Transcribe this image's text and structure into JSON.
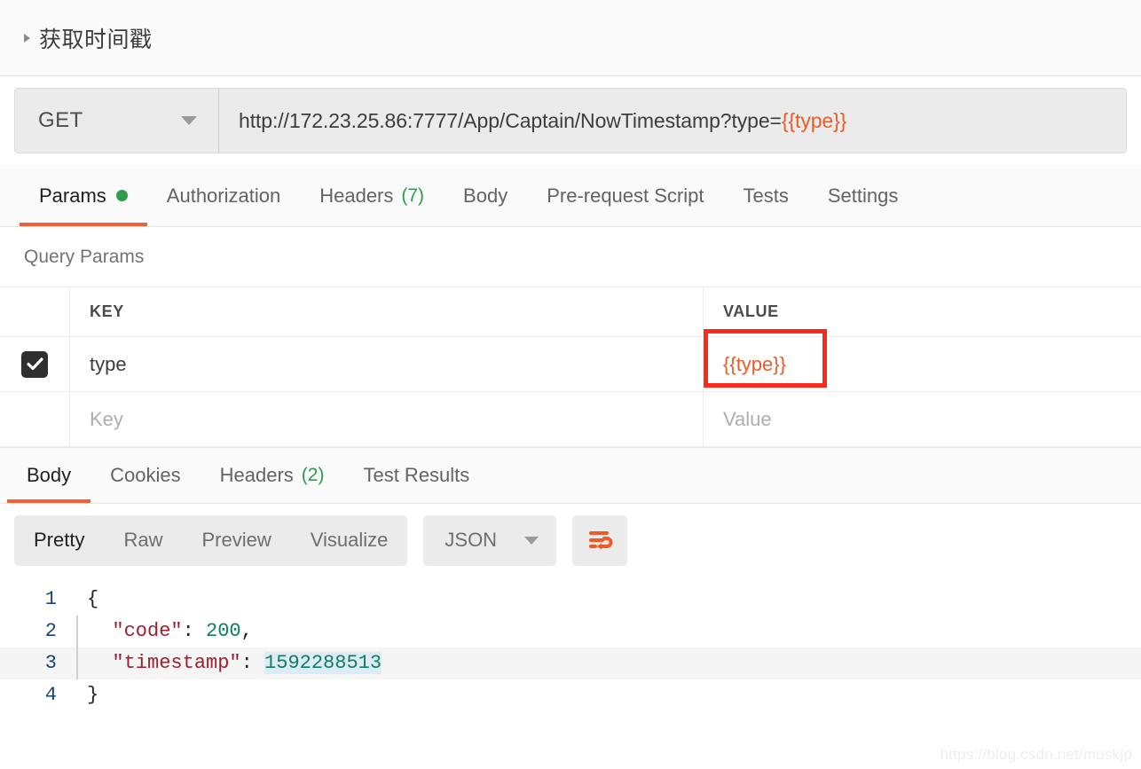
{
  "request": {
    "title": "获取时间戳",
    "collapse_icon": "triangle-right-icon",
    "method": "GET",
    "url_prefix": "http://172.23.25.86:7777/App/Captain/NowTimestamp?type=",
    "url_variable": "{{type}}",
    "tabs": [
      {
        "label": "Params",
        "active": true,
        "indicator": "dot",
        "count": ""
      },
      {
        "label": "Authorization",
        "active": false,
        "indicator": "",
        "count": ""
      },
      {
        "label": "Headers",
        "active": false,
        "indicator": "count",
        "count": "(7)"
      },
      {
        "label": "Body",
        "active": false,
        "indicator": "",
        "count": ""
      },
      {
        "label": "Pre-request Script",
        "active": false,
        "indicator": "",
        "count": ""
      },
      {
        "label": "Tests",
        "active": false,
        "indicator": "",
        "count": ""
      },
      {
        "label": "Settings",
        "active": false,
        "indicator": "",
        "count": ""
      }
    ]
  },
  "query_params": {
    "section_title": "Query Params",
    "columns": {
      "key": "KEY",
      "value": "VALUE"
    },
    "rows": [
      {
        "checked": true,
        "key": "type",
        "value": "{{type}}",
        "highlighted": true
      },
      {
        "checked": false,
        "key": "Key",
        "value": "Value",
        "highlighted": false
      }
    ]
  },
  "response": {
    "tabs": [
      {
        "label": "Body",
        "active": true,
        "count": ""
      },
      {
        "label": "Cookies",
        "active": false,
        "count": ""
      },
      {
        "label": "Headers",
        "active": false,
        "count": "(2)"
      },
      {
        "label": "Test Results",
        "active": false,
        "count": ""
      }
    ],
    "view_modes": [
      {
        "label": "Pretty",
        "active": true
      },
      {
        "label": "Raw",
        "active": false
      },
      {
        "label": "Preview",
        "active": false
      },
      {
        "label": "Visualize",
        "active": false
      }
    ],
    "format": "JSON",
    "wrap_icon": "word-wrap-icon",
    "code_lines": [
      {
        "num": "1",
        "nested": false,
        "highlight": false,
        "tokens": [
          {
            "t": "{",
            "c": "brace"
          }
        ]
      },
      {
        "num": "2",
        "nested": true,
        "highlight": false,
        "tokens": [
          {
            "t": "  \"code\"",
            "c": "key"
          },
          {
            "t": ": ",
            "c": "punc"
          },
          {
            "t": "200",
            "c": "num"
          },
          {
            "t": ",",
            "c": "punc"
          }
        ]
      },
      {
        "num": "3",
        "nested": true,
        "highlight": true,
        "tokens": [
          {
            "t": "  \"timestamp\"",
            "c": "key"
          },
          {
            "t": ": ",
            "c": "punc"
          },
          {
            "t": "1592288513",
            "c": "num-sel"
          }
        ]
      },
      {
        "num": "4",
        "nested": false,
        "highlight": false,
        "tokens": [
          {
            "t": "}",
            "c": "brace"
          }
        ]
      }
    ]
  },
  "watermark": "https://blog.csdn.net/muskjp",
  "colors": {
    "accent_orange": "#f0613a",
    "variable_orange": "#ef5b25",
    "badge_green": "#26a148",
    "dot_green": "#2e9b4e",
    "annotation_red": "#fa2a1b",
    "json_key_red": "#9c1f2e",
    "json_value_green": "#10805a",
    "gutter_blue": "#17427a"
  }
}
